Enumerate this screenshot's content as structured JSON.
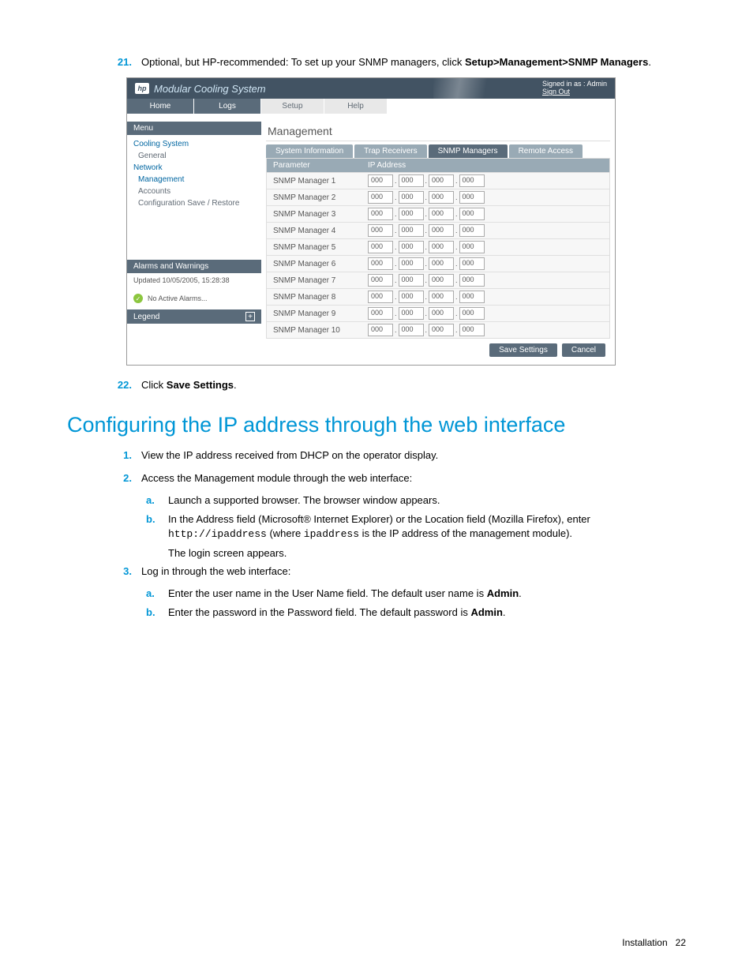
{
  "steps": {
    "s21_num": "21.",
    "s21_text_a": "Optional, but HP-recommended: To set up your SNMP managers, click ",
    "s21_bold": "Setup>Management>SNMP Managers",
    "s21_period": ".",
    "s22_num": "22.",
    "s22_text_a": "Click ",
    "s22_bold": "Save Settings",
    "s22_period": "."
  },
  "screenshot": {
    "title": "Modular Cooling System",
    "signed_in": "Signed in as : Admin",
    "sign_out": "Sign Out",
    "nav": {
      "home": "Home",
      "logs": "Logs",
      "setup": "Setup",
      "help": "Help"
    },
    "menu_hdr": "Menu",
    "menu": {
      "cooling": "Cooling System",
      "general": "General",
      "network": "Network",
      "management": "Management",
      "accounts": "Accounts",
      "config": "Configuration Save / Restore"
    },
    "alarms_hdr": "Alarms and Warnings",
    "updated": "Updated 10/05/2005, 15:28:38",
    "no_alarms": "No Active Alarms...",
    "legend_hdr": "Legend",
    "main_title": "Management",
    "tabs": {
      "sysinfo": "System Information",
      "trap": "Trap Receivers",
      "snmp": "SNMP Managers",
      "remote": "Remote Access"
    },
    "col_param": "Parameter",
    "col_ip": "IP Address",
    "rows": [
      "SNMP Manager 1",
      "SNMP Manager 2",
      "SNMP Manager 3",
      "SNMP Manager 4",
      "SNMP Manager 5",
      "SNMP Manager 6",
      "SNMP Manager 7",
      "SNMP Manager 8",
      "SNMP Manager 9",
      "SNMP Manager 10"
    ],
    "ip_val": "000",
    "save_btn": "Save Settings",
    "cancel_btn": "Cancel"
  },
  "h2": "Configuring the IP address through the web interface",
  "list": {
    "n1_num": "1.",
    "n1_text": "View the IP address received from DHCP on the operator display.",
    "n2_num": "2.",
    "n2_text": "Access the Management module through the web interface:",
    "n2a_l": "a.",
    "n2a_t": "Launch a supported browser. The browser window appears.",
    "n2b_l": "b.",
    "n2b_t1": "In the Address field (Microsoft® Internet Explorer) or the Location field (Mozilla Firefox), enter ",
    "n2b_code1": "http://ipaddress",
    "n2b_t2": " (where ",
    "n2b_code2": "ipaddress",
    "n2b_t3": " is the IP address of the management module).",
    "n2b_note": "The login screen appears.",
    "n3_num": "3.",
    "n3_text": "Log in through the web interface:",
    "n3a_l": "a.",
    "n3a_t1": "Enter the user name in the User Name field. The default user name is ",
    "n3a_bold": "Admin",
    "n3a_t2": ".",
    "n3b_l": "b.",
    "n3b_t1": "Enter the password in the Password field. The default password is ",
    "n3b_bold": "Admin",
    "n3b_t2": "."
  },
  "footer": {
    "label": "Installation",
    "page": "22"
  }
}
